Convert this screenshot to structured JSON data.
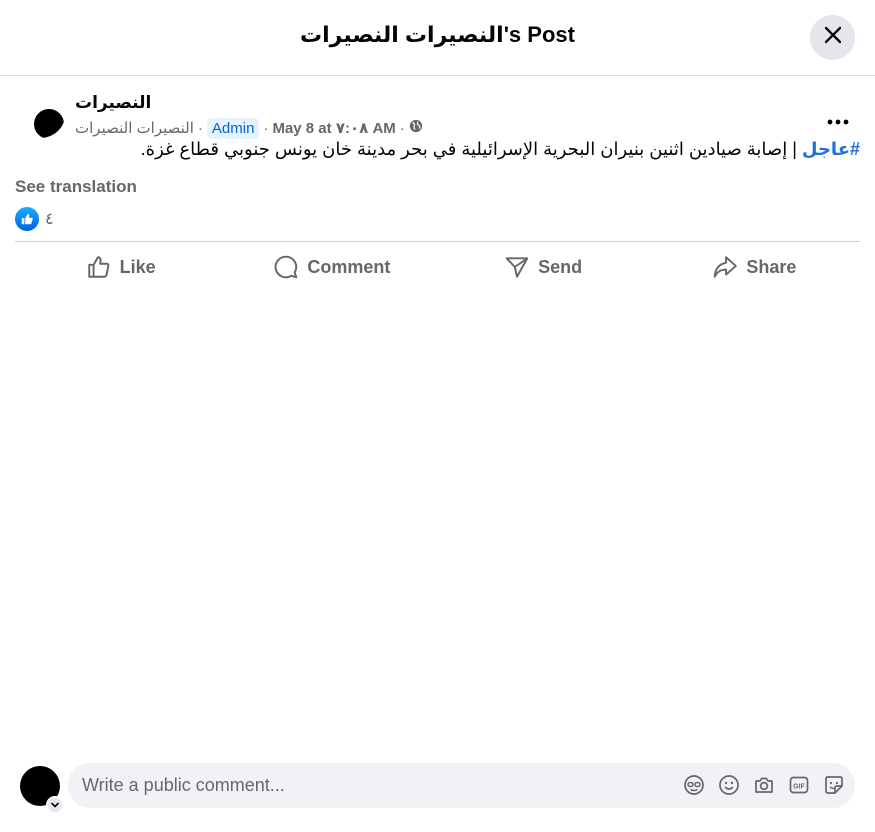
{
  "dialog": {
    "title": "النصيرات النصيرات's Post",
    "close_icon": "close-icon"
  },
  "post": {
    "author": "النصيرات",
    "group_name": "النصيرات النصيرات",
    "separator": "·",
    "role_badge": "Admin",
    "timestamp": "May 8 at ٧:٠٨ AM",
    "privacy_icon": "globe-icon",
    "more_icon": "more-options-icon",
    "hashtag": "#عاجل",
    "text": " | إصابة صيادين اثنين بنيران البحرية الإسرائيلية في بحر مدينة خان يونس جنوبي قطاع غزة.",
    "see_translation": "See translation",
    "reaction_count": "٤"
  },
  "actions": {
    "like": "Like",
    "comment": "Comment",
    "send": "Send",
    "share": "Share"
  },
  "composer": {
    "placeholder": "Write a public comment...",
    "tools": [
      "avatar-sticker-icon",
      "emoji-icon",
      "camera-icon",
      "gif-icon",
      "sticker-icon"
    ]
  },
  "colors": {
    "accent": "#0866ff",
    "hashtag": "#216fdb",
    "secondary_text": "#65676b",
    "badge_bg": "#e7f3ff"
  }
}
